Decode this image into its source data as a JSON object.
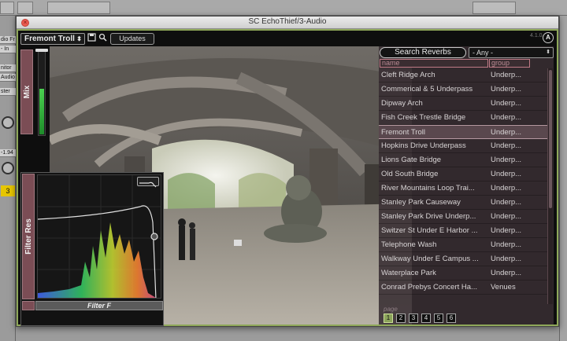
{
  "window": {
    "title": "SC EchoThief/3-Audio",
    "close_glyph": "×"
  },
  "host": {
    "left_labels": [
      "dio Fr",
      "- In",
      "nitor",
      "Audio",
      "ster"
    ],
    "left_numbers": [
      "-1.94",
      "3"
    ]
  },
  "toolbar": {
    "preset": "Fremont Troll",
    "preset_arrow": "⬍",
    "updates_label": "Updates",
    "version": "4.1.0",
    "logo_glyph": "A"
  },
  "mix": {
    "label": "Mix",
    "level": 0.55
  },
  "filter": {
    "res_label": "Filter Res",
    "freq_label": "Filter F"
  },
  "browser": {
    "search_label": "Search Reverbs",
    "group_filter": "- Any -",
    "group_arrow": "⬍",
    "columns": {
      "name": "name",
      "group": "group"
    },
    "rows": [
      {
        "name": "Cleft Ridge Arch",
        "group": "Underp..."
      },
      {
        "name": "Commerical & 5 Underpass",
        "group": "Underp..."
      },
      {
        "name": "Dipway Arch",
        "group": "Underp..."
      },
      {
        "name": "Fish Creek Trestle Bridge",
        "group": "Underp..."
      },
      {
        "name": "Fremont Troll",
        "group": "Underp...",
        "selected": true
      },
      {
        "name": "Hopkins Drive Underpass",
        "group": "Underp..."
      },
      {
        "name": "Lions Gate Bridge",
        "group": "Underp..."
      },
      {
        "name": "Old South Bridge",
        "group": "Underp..."
      },
      {
        "name": "River Mountains Loop Trai...",
        "group": "Underp..."
      },
      {
        "name": "Stanley Park Causeway",
        "group": "Underp..."
      },
      {
        "name": "Stanley Park Drive Underp...",
        "group": "Underp..."
      },
      {
        "name": "Switzer St Under E Harbor ...",
        "group": "Underp..."
      },
      {
        "name": "Telephone Wash",
        "group": "Underp..."
      },
      {
        "name": "Walkway Under E Campus ...",
        "group": "Underp..."
      },
      {
        "name": "Waterplace Park",
        "group": "Underp..."
      },
      {
        "name": "Conrad Prebys Concert Ha...",
        "group": "Venues"
      }
    ],
    "page_label": "page",
    "pages": [
      "1",
      "2",
      "3",
      "4",
      "5",
      "6"
    ],
    "active_page": "1"
  },
  "colors": {
    "frame_accent": "#8fa85a",
    "panel_label_bg": "#7b4d55",
    "selection_bg": "#5a484e",
    "mix_meter": "#4ad050"
  }
}
